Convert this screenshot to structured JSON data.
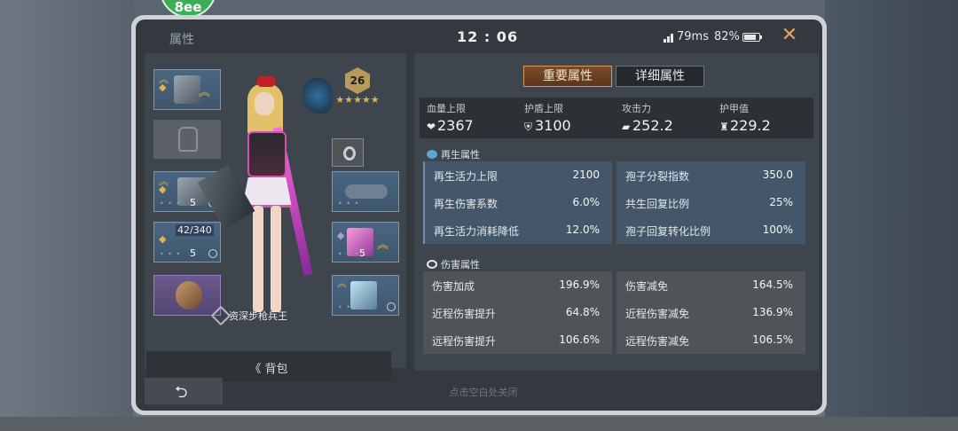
{
  "overlay": {
    "badge_text": "8ee"
  },
  "status": {
    "tab_title": "属性",
    "clock": "12 : 06",
    "ping": "79ms",
    "battery_pct": "82%",
    "battery_level": 0.82,
    "close_glyph": "✕"
  },
  "character": {
    "rank": "26",
    "stars": "★★★★★",
    "title": "资深步枪兵王"
  },
  "equipment": {
    "slot_weapon_ammo": "42/340",
    "slot_counts": [
      "5",
      "5",
      "5"
    ]
  },
  "bag": {
    "label": "《 背包"
  },
  "tabs": {
    "key_attrs": "重要属性",
    "detail_attrs": "详细属性"
  },
  "stats": [
    {
      "label": "血量上限",
      "value": "2367",
      "icon": "heart-icon"
    },
    {
      "label": "护盾上限",
      "value": "3100",
      "icon": "shield-icon"
    },
    {
      "label": "攻击力",
      "value": "252.2",
      "icon": "gun-icon"
    },
    {
      "label": "护甲值",
      "value": "229.2",
      "icon": "armor-icon"
    }
  ],
  "regen": {
    "header": "再生属性",
    "left": [
      {
        "label": "再生活力上限",
        "value": "2100"
      },
      {
        "label": "再生伤害系数",
        "value": "6.0%"
      },
      {
        "label": "再生活力消耗降低",
        "value": "12.0%"
      }
    ],
    "right": [
      {
        "label": "孢子分裂指数",
        "value": "350.0"
      },
      {
        "label": "共生回复比例",
        "value": "25%"
      },
      {
        "label": "孢子回复转化比例",
        "value": "100%"
      }
    ]
  },
  "damage": {
    "header": "伤害属性",
    "left": [
      {
        "label": "伤害加成",
        "value": "196.9%"
      },
      {
        "label": "近程伤害提升",
        "value": "64.8%"
      },
      {
        "label": "远程伤害提升",
        "value": "106.6%"
      }
    ],
    "right": [
      {
        "label": "伤害减免",
        "value": "164.5%"
      },
      {
        "label": "近程伤害减免",
        "value": "136.9%"
      },
      {
        "label": "远程伤害减免",
        "value": "106.5%"
      }
    ]
  },
  "footer": {
    "back_glyph": "⮌",
    "close_hint": "点击空白处关闭"
  },
  "colors": {
    "accent": "#d79a5c",
    "blue_row": "#44576a",
    "gray_row": "#4f5459"
  }
}
